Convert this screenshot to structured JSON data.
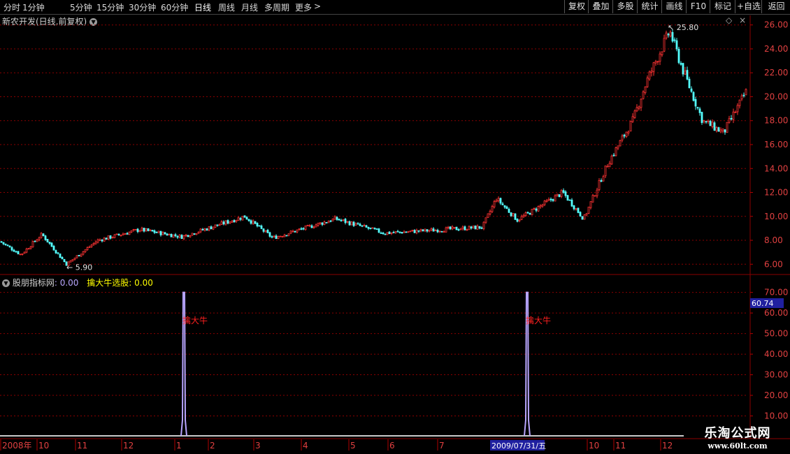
{
  "toolbar": {
    "timeframes": [
      "分时",
      "1分钟",
      "5分钟",
      "15分钟",
      "30分钟",
      "60分钟",
      "日线",
      "周线",
      "月线",
      "多周期",
      "更多"
    ],
    "active_timeframe": "日线",
    "more_arrow": ">",
    "right_buttons": [
      "复权",
      "叠加",
      "多股",
      "统计",
      "画线",
      "F10",
      "标记",
      "+自选",
      "返回"
    ]
  },
  "main_chart": {
    "title": "新农开发(日线,前复权)",
    "high_label": "25.80",
    "low_label": "5.90",
    "price_axis": [
      "26.00",
      "24.00",
      "22.00",
      "20.00",
      "18.00",
      "16.00",
      "14.00",
      "12.00",
      "10.00",
      "8.00",
      "6.00"
    ]
  },
  "indicator": {
    "name": "股朋指标网",
    "name_value": ": 0.00",
    "signal_name": "擒大牛选股",
    "signal_value": ": 0.00",
    "signal_label": "擒大牛",
    "current_value": "60.74",
    "axis": [
      "70.00",
      "60.00",
      "50.00",
      "40.00",
      "30.00",
      "20.00",
      "10.00"
    ],
    "line_color": "#b9a6ff",
    "spikes": [
      {
        "date_index": 264,
        "value": 70
      },
      {
        "date_index": 755,
        "value": 70
      }
    ]
  },
  "date_axis": {
    "labels": [
      "2008年",
      "10",
      "11",
      "12",
      "1",
      "2",
      "3",
      "4",
      "5",
      "6",
      "7",
      "10",
      "11",
      "12"
    ],
    "cursor_date": "2009/07/31/五"
  },
  "watermark": {
    "line1": "乐淘公式网",
    "line2": "www.60lt.com"
  },
  "chart_data": {
    "type": "candlestick",
    "ylim": [
      5.2,
      26.8
    ],
    "up_color": "#ff3333",
    "down_color": "#54ffff",
    "key_points": [
      {
        "x": 0,
        "price": 7.9
      },
      {
        "x": 30,
        "price": 6.8
      },
      {
        "x": 60,
        "price": 8.5
      },
      {
        "x": 95,
        "price": 6.0
      },
      {
        "x": 140,
        "price": 8.0
      },
      {
        "x": 200,
        "price": 8.9
      },
      {
        "x": 260,
        "price": 8.3
      },
      {
        "x": 350,
        "price": 10.0
      },
      {
        "x": 390,
        "price": 8.2
      },
      {
        "x": 480,
        "price": 9.8
      },
      {
        "x": 550,
        "price": 8.6
      },
      {
        "x": 690,
        "price": 9.1
      },
      {
        "x": 710,
        "price": 11.5
      },
      {
        "x": 740,
        "price": 9.7
      },
      {
        "x": 805,
        "price": 12.0
      },
      {
        "x": 835,
        "price": 9.8
      },
      {
        "x": 870,
        "price": 14.5
      },
      {
        "x": 905,
        "price": 18.0
      },
      {
        "x": 925,
        "price": 21.3
      },
      {
        "x": 958,
        "price": 25.5
      },
      {
        "x": 975,
        "price": 22.5
      },
      {
        "x": 1005,
        "price": 18.0
      },
      {
        "x": 1035,
        "price": 17.0
      },
      {
        "x": 1068,
        "price": 20.5
      }
    ]
  }
}
